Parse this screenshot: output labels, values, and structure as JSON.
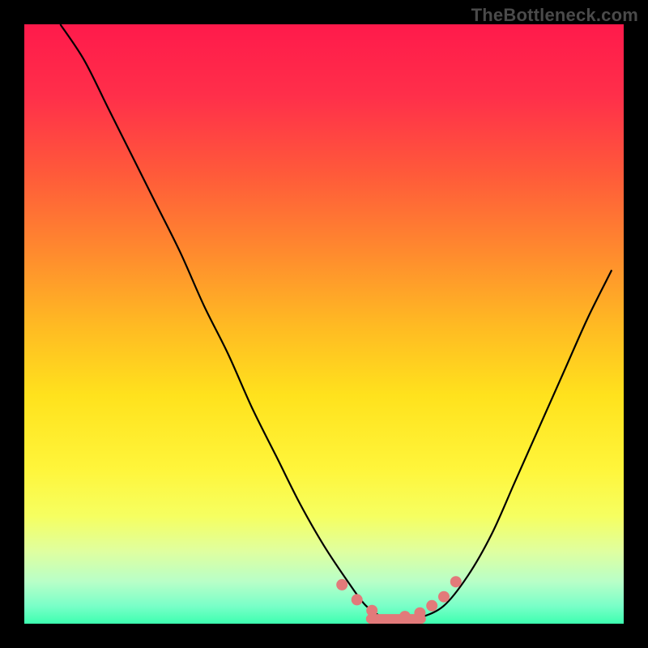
{
  "watermark": "TheBottleneck.com",
  "gradient": {
    "stops": [
      {
        "offset": 0.0,
        "color": "#ff1a4b"
      },
      {
        "offset": 0.12,
        "color": "#ff2f4a"
      },
      {
        "offset": 0.25,
        "color": "#ff5a3a"
      },
      {
        "offset": 0.38,
        "color": "#ff8a2e"
      },
      {
        "offset": 0.5,
        "color": "#ffb923"
      },
      {
        "offset": 0.62,
        "color": "#ffe21d"
      },
      {
        "offset": 0.74,
        "color": "#fff53a"
      },
      {
        "offset": 0.82,
        "color": "#f6ff60"
      },
      {
        "offset": 0.88,
        "color": "#dfffa0"
      },
      {
        "offset": 0.93,
        "color": "#b8ffc8"
      },
      {
        "offset": 0.97,
        "color": "#7affc8"
      },
      {
        "offset": 1.0,
        "color": "#3dffb0"
      }
    ]
  },
  "chart_data": {
    "type": "line",
    "title": "",
    "xlabel": "",
    "ylabel": "",
    "xlim": [
      0,
      100
    ],
    "ylim": [
      0,
      100
    ],
    "series": [
      {
        "name": "curve",
        "x": [
          6,
          10,
          14,
          18,
          22,
          26,
          30,
          34,
          38,
          42,
          46,
          50,
          54,
          57,
          60,
          63,
          66,
          70,
          74,
          78,
          82,
          86,
          90,
          94,
          98
        ],
        "y": [
          100,
          94,
          86,
          78,
          70,
          62,
          53,
          45,
          36,
          28,
          20,
          13,
          7,
          3,
          1,
          0.5,
          1,
          3,
          8,
          15,
          24,
          33,
          42,
          51,
          59
        ]
      }
    ],
    "highlight": {
      "name": "good-zone",
      "color": "#e27a7a",
      "dots_x": [
        53,
        55.5,
        58,
        63.5,
        66,
        68,
        70,
        72
      ],
      "dots_y": [
        6.5,
        4,
        2.2,
        1.2,
        1.8,
        3,
        4.5,
        7
      ],
      "bar_y": 0.8,
      "bar_x": [
        57,
        67
      ]
    }
  }
}
